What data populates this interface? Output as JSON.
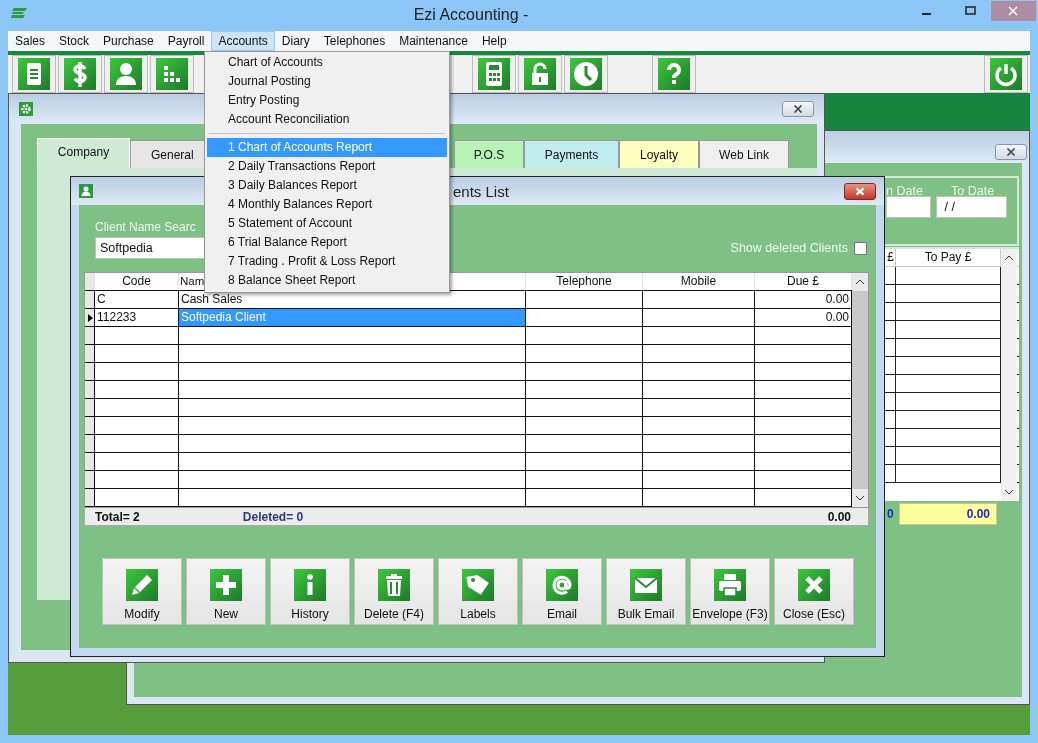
{
  "window": {
    "title": "Ezi Accounting -"
  },
  "menu_bar": [
    {
      "label": "Sales",
      "selected": false
    },
    {
      "label": "Stock",
      "selected": false
    },
    {
      "label": "Purchase",
      "selected": false
    },
    {
      "label": "Payroll",
      "selected": false
    },
    {
      "label": "Accounts",
      "selected": true
    },
    {
      "label": "Diary",
      "selected": false
    },
    {
      "label": "Telephones",
      "selected": false
    },
    {
      "label": "Maintenance",
      "selected": false
    },
    {
      "label": "Help",
      "selected": false
    }
  ],
  "accounts_menu": {
    "groups": [
      [
        {
          "label": "Chart of Accounts",
          "selected": false
        },
        {
          "label": "Journal Posting",
          "selected": false
        },
        {
          "label": "Entry Posting",
          "selected": false
        },
        {
          "label": "Account Reconciliation",
          "selected": false
        }
      ],
      [
        {
          "label": "1 Chart of Accounts Report",
          "selected": true
        },
        {
          "label": "2 Daily Transactions Report",
          "selected": false
        },
        {
          "label": "3 Daily Balances Report",
          "selected": false
        },
        {
          "label": "4 Monthly Balances Report",
          "selected": false
        },
        {
          "label": "5 Statement of Account",
          "selected": false
        },
        {
          "label": "6 Trial Balance Report",
          "selected": false
        },
        {
          "label": "7 Trading . Profit & Loss Report",
          "selected": false
        },
        {
          "label": "8 Balance Sheet Report",
          "selected": false
        }
      ]
    ]
  },
  "company_window": {
    "tabs": [
      {
        "label": "Company",
        "selected": true,
        "color": "#cfe9d7"
      },
      {
        "label": "General",
        "selected": false,
        "color": "#e6e6e6"
      },
      {
        "label": "P.O.S",
        "selected": false,
        "color": "#b8f4b8"
      },
      {
        "label": "Payments",
        "selected": false,
        "color": "#c1ecf0"
      },
      {
        "label": "Loyalty",
        "selected": false,
        "color": "#fefec0"
      },
      {
        "label": "Web Link",
        "selected": false,
        "color": "#efefef"
      }
    ]
  },
  "back_window": {
    "from_date_label": "n Date",
    "to_date": {
      "label": "To Date",
      "value": " / /"
    },
    "columns": [
      "£",
      "To Pay £"
    ],
    "footer_cut": "0",
    "footer_total": "0.00"
  },
  "clients_window": {
    "title": "ents List",
    "search": {
      "label": "Client Name Searc",
      "value": "Softpedia"
    },
    "show_deleted": {
      "label": "Show deleted Clients",
      "checked": false
    },
    "columns": [
      "Code",
      "Nam",
      "Telephone",
      "Mobile",
      "Due £"
    ],
    "rows": [
      {
        "code": "C",
        "name": "Cash Sales",
        "due": "0.00",
        "selected": false
      },
      {
        "code": "112233",
        "name": "Softpedia Client",
        "due": "0.00",
        "selected": true
      }
    ],
    "footer": {
      "total": "Total= 2",
      "deleted": "Deleted= 0",
      "sum": "0.00"
    },
    "buttons": [
      "Modify",
      "New",
      "History",
      "Delete (F4)",
      "Labels",
      "Email",
      "Bulk Email",
      "Envelope (F3)",
      "Close (Esc)"
    ]
  }
}
